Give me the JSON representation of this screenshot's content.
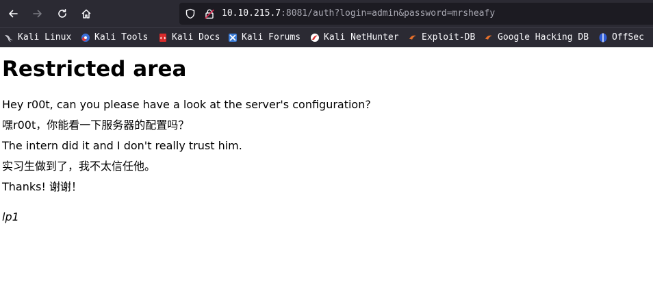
{
  "browser": {
    "url_host": "10.10.215.7",
    "url_rest": ":8081/auth?login=admin&password=mrsheafy"
  },
  "bookmarks": [
    {
      "label": "Kali Linux",
      "icon": "kali-dragon-icon"
    },
    {
      "label": "Kali Tools",
      "icon": "kali-tools-icon"
    },
    {
      "label": "Kali Docs",
      "icon": "kali-docs-icon"
    },
    {
      "label": "Kali Forums",
      "icon": "kali-forums-icon"
    },
    {
      "label": "Kali NetHunter",
      "icon": "kali-nethunter-icon"
    },
    {
      "label": "Exploit-DB",
      "icon": "exploit-db-icon"
    },
    {
      "label": "Google Hacking DB",
      "icon": "ghdb-icon"
    },
    {
      "label": "OffSec",
      "icon": "offsec-icon"
    }
  ],
  "page": {
    "heading": "Restricted area",
    "line1": "Hey r00t, can you please have a look at the server's configuration?",
    "line2": "嘿r00t，你能看一下服务器的配置吗？",
    "line3": "The intern did it and I don't really trust him.",
    "line4": "实习生做到了，我不太信任他。",
    "line5": "Thanks! 谢谢！",
    "signature": "lp1"
  }
}
